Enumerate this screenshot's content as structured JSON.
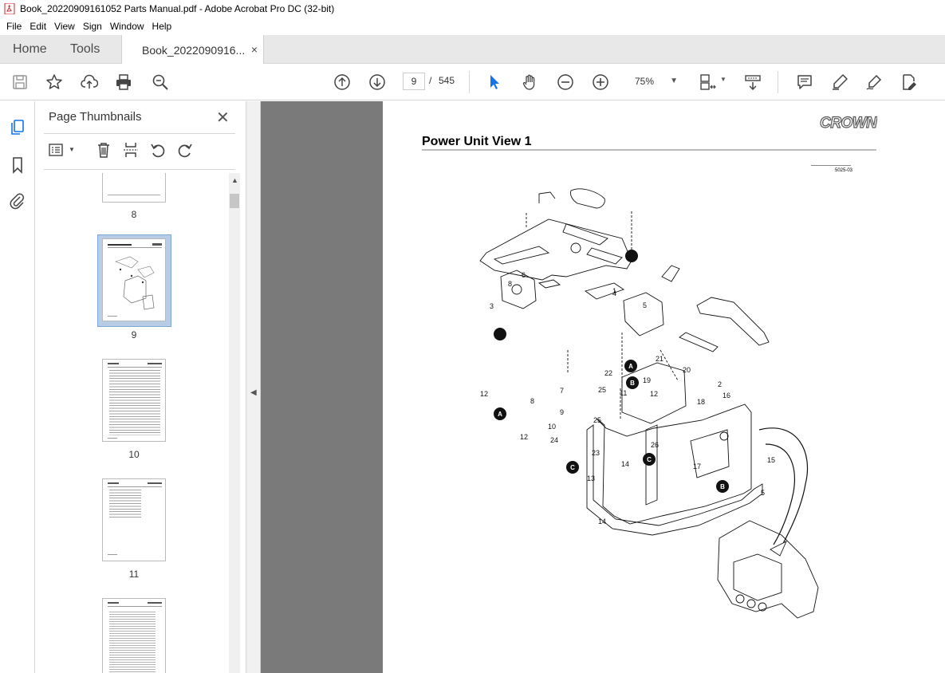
{
  "window": {
    "title": "Book_20220909161052 Parts Manual.pdf - Adobe Acrobat Pro DC (32-bit)"
  },
  "menu": [
    "File",
    "Edit",
    "View",
    "Sign",
    "Window",
    "Help"
  ],
  "tabs": {
    "home": "Home",
    "tools": "Tools",
    "document": "Book_2022090916...",
    "close": "×"
  },
  "toolbar": {
    "current_page": "9",
    "separator": "/",
    "total_pages": "545",
    "zoom": "75%"
  },
  "thumbnail_pane": {
    "title": "Page Thumbnails",
    "pages": [
      {
        "label": "8",
        "selected": false
      },
      {
        "label": "9",
        "selected": true
      },
      {
        "label": "10",
        "selected": false
      },
      {
        "label": "11",
        "selected": false
      },
      {
        "label": "",
        "selected": false
      }
    ]
  },
  "document": {
    "brand": "CROWN",
    "page_title": "Power Unit View 1",
    "figure_code": "5025-03",
    "callouts": [
      "1",
      "2",
      "3",
      "4",
      "5",
      "5",
      "6",
      "7",
      "8",
      "8",
      "9",
      "10",
      "11",
      "12",
      "12",
      "12",
      "13",
      "14",
      "14",
      "15",
      "16",
      "17",
      "18",
      "19",
      "20",
      "21",
      "22",
      "23",
      "24",
      "25",
      "25",
      "26",
      "27",
      "A",
      "A",
      "B",
      "B",
      "C",
      "C"
    ]
  },
  "colors": {
    "accent_blue": "#1473e6",
    "tabbar_bg": "#e8e8e8",
    "doc_bg": "#7a7a7a",
    "acrobat_red": "#d4222a"
  }
}
